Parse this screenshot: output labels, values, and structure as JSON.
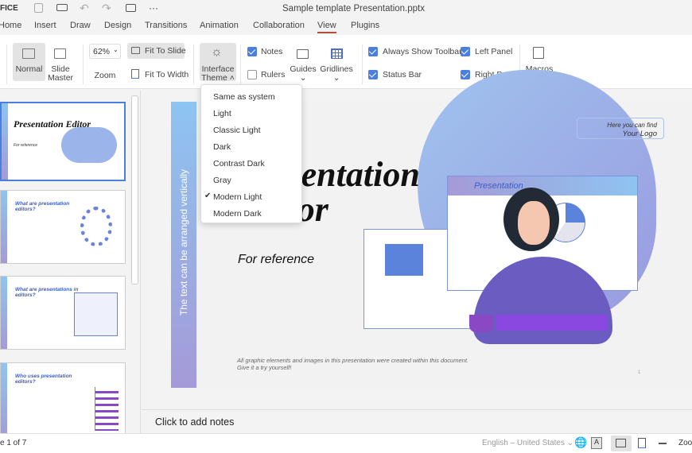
{
  "app": {
    "brand": "FICE",
    "title": "Sample template Presentation.pptx"
  },
  "quick_icons": [
    "save-icon",
    "print-icon",
    "undo-icon",
    "redo-icon",
    "slideshow-icon",
    "more-icon"
  ],
  "more_label": "···",
  "tabs": [
    {
      "label": "Home"
    },
    {
      "label": "Insert"
    },
    {
      "label": "Draw"
    },
    {
      "label": "Design"
    },
    {
      "label": "Transitions"
    },
    {
      "label": "Animation"
    },
    {
      "label": "Collaboration"
    },
    {
      "label": "View",
      "active": true
    },
    {
      "label": "Plugins"
    }
  ],
  "toolbar": {
    "normal": "Normal",
    "slide_master_1": "Slide",
    "slide_master_2": "Master",
    "zoom_value": "62%",
    "zoom": "Zoom",
    "fit_slide": "Fit To Slide",
    "fit_width": "Fit To Width",
    "theme_1": "Interface",
    "theme_2": "Theme",
    "notes": "Notes",
    "rulers": "Rulers",
    "guides": "Guides",
    "gridlines": "Gridlines",
    "always_toolbar": "Always Show Toolbar",
    "status_bar": "Status Bar",
    "left_panel": "Left Panel",
    "right_panel": "Right Panel",
    "macros": "Macros",
    "checks": {
      "notes": true,
      "rulers": false,
      "always_toolbar": true,
      "status_bar": true,
      "left_panel": true,
      "right_panel": true
    }
  },
  "theme_menu": {
    "items": [
      "Same as system",
      "Light",
      "Classic Light",
      "Dark",
      "Contrast Dark",
      "Gray",
      "Modern Light",
      "Modern Dark"
    ],
    "selected": "Modern Light"
  },
  "slide": {
    "vertical_text": "The text can be arranged vertically",
    "title_1": "Presentation",
    "title_2": "Editor",
    "subtitle": "For reference",
    "logo_1": "Here you can find",
    "logo_2": "Your Logo",
    "screen_label": "Presentation",
    "footer_1": "All graphic elements and images in this presentation were created within this document.",
    "footer_2": "Give it a try yourself!",
    "number": "1"
  },
  "thumbnails": [
    {
      "title": "Presentation Editor",
      "sub": "For reference"
    },
    {
      "title": "What are presentation editors?"
    },
    {
      "title": "What are presentations in editors?"
    },
    {
      "title": "Who uses presentation editors?"
    }
  ],
  "notes_placeholder": "Click to add notes",
  "status": {
    "slide": "e 1 of 7",
    "language": "English – United States",
    "zoom": "Zoo"
  },
  "colors": {
    "accent": "#4a7fe0",
    "active_tab": "#b0503a",
    "gradient_top": "#8ec4f0",
    "gradient_bottom": "#a59ad8"
  }
}
